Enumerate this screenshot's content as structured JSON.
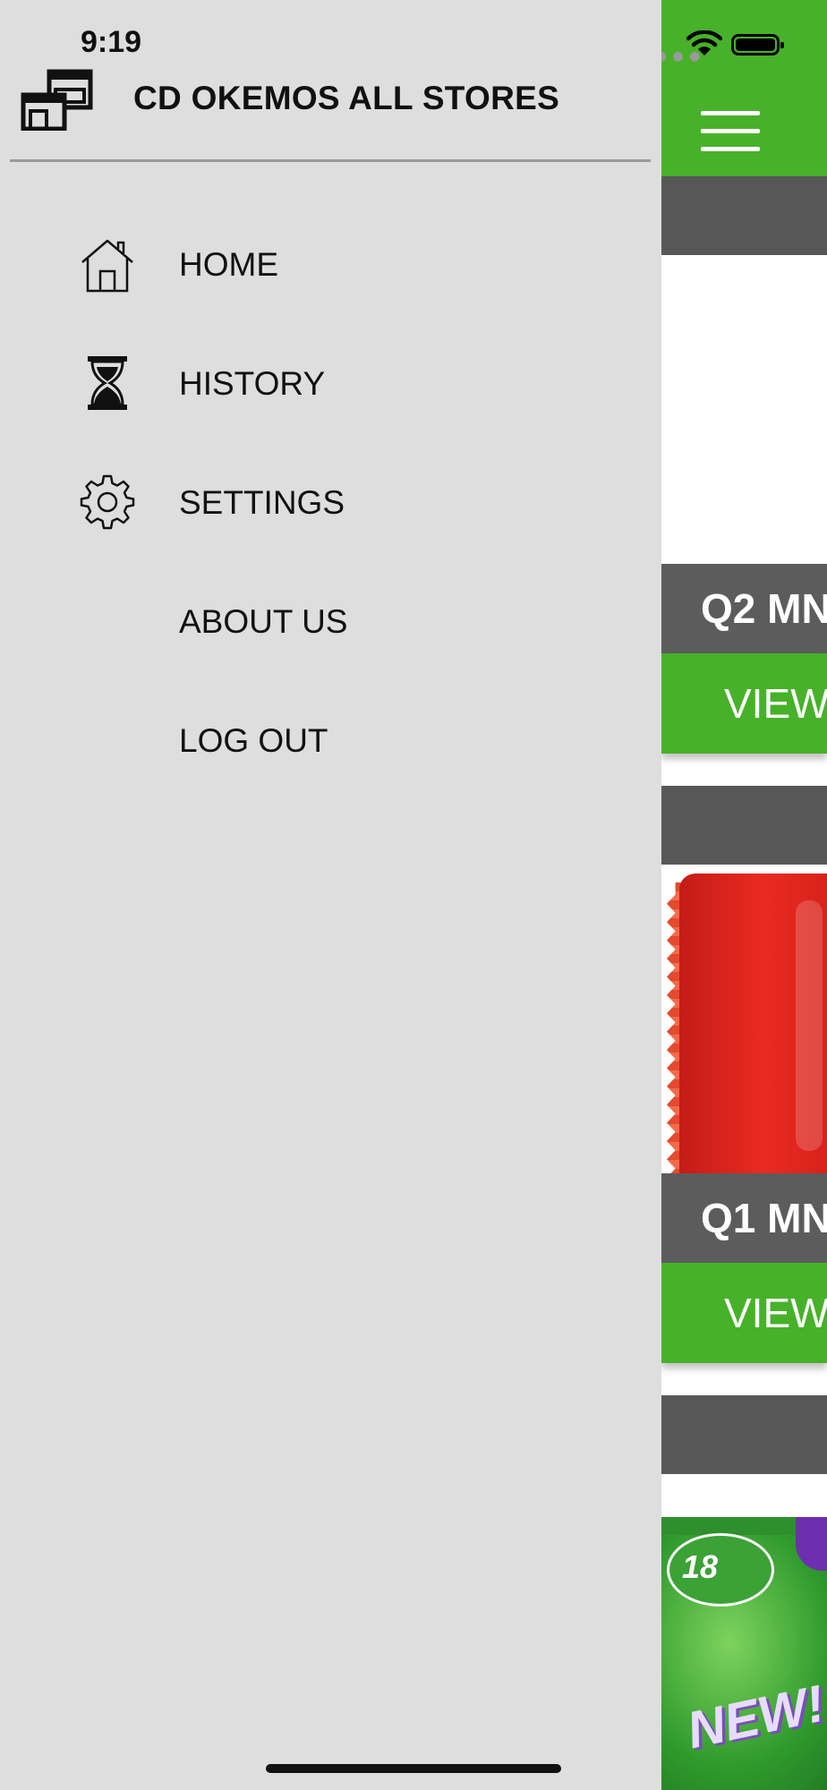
{
  "status_bar": {
    "time": "9:19"
  },
  "drawer": {
    "store_name": "CD OKEMOS ALL STORES",
    "menu": [
      {
        "label": "HOME",
        "icon": "home-icon"
      },
      {
        "label": "HISTORY",
        "icon": "hourglass-icon"
      },
      {
        "label": "SETTINGS",
        "icon": "gear-icon"
      },
      {
        "label": "ABOUT US",
        "icon": ""
      },
      {
        "label": "LOG OUT",
        "icon": ""
      }
    ]
  },
  "main": {
    "menu_icon": "hamburger-icon",
    "cards": [
      {
        "title": "Q2 MN",
        "button": "VIEW"
      },
      {
        "title": "Q1 MN",
        "button": "VIEW"
      }
    ]
  },
  "colors": {
    "accent_green": "#47b12a",
    "drawer_bg": "#dedede",
    "card_header": "#575757"
  }
}
